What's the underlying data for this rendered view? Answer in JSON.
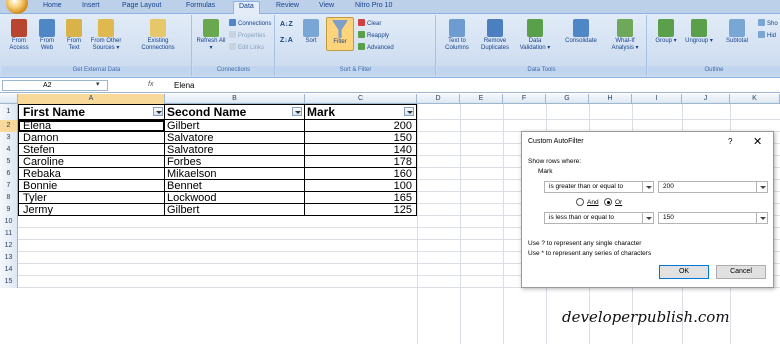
{
  "tabs": [
    "Home",
    "Insert",
    "Page Layout",
    "Formulas",
    "Data",
    "Review",
    "View",
    "Nitro Pro 10"
  ],
  "ribbon": {
    "get_external": {
      "label": "Get External Data",
      "buttons": [
        "From Access",
        "From Web",
        "From Text",
        "From Other Sources ▾",
        "Existing Connections"
      ]
    },
    "connections": {
      "label": "Connections",
      "refresh": "Refresh All ▾",
      "items": [
        "Connections",
        "Properties",
        "Edit Links"
      ]
    },
    "sort_filter": {
      "label": "Sort & Filter",
      "sort": "Sort",
      "filter": "Filter",
      "items": [
        "Clear",
        "Reapply",
        "Advanced"
      ]
    },
    "data_tools": {
      "label": "Data Tools",
      "buttons": [
        "Text to Columns",
        "Remove Duplicates",
        "Data Validation ▾",
        "Consolidate",
        "What-If Analysis ▾"
      ]
    },
    "outline": {
      "label": "Outline",
      "buttons": [
        "Group ▾",
        "Ungroup ▾",
        "Subtotal"
      ],
      "side": [
        "Sho",
        "Hid"
      ]
    }
  },
  "formula_bar": {
    "name_box": "A2",
    "fx": "fx",
    "value": "Elena"
  },
  "columns": [
    "A",
    "B",
    "C",
    "D",
    "E",
    "F",
    "G",
    "H",
    "I",
    "J",
    "K"
  ],
  "row_numbers": [
    "1",
    "2",
    "3",
    "4",
    "5",
    "6",
    "7",
    "8",
    "9",
    "10",
    "11",
    "12",
    "13",
    "14",
    "15"
  ],
  "table": {
    "headers": [
      "First Name",
      "Second Name",
      "Mark"
    ],
    "rows": [
      [
        "Elena",
        "Gilbert",
        "200"
      ],
      [
        "Damon",
        "Salvatore",
        "150"
      ],
      [
        "Stefen",
        "Salvatore",
        "140"
      ],
      [
        "Caroline",
        "Forbes",
        "178"
      ],
      [
        "Rebaka",
        "Mikaelson",
        "160"
      ],
      [
        "Bonnie",
        "Bennet",
        "100"
      ],
      [
        "Tyler",
        "Lockwood",
        "165"
      ],
      [
        "Jermy",
        "Gilbert",
        "125"
      ]
    ]
  },
  "dialog": {
    "title": "Custom AutoFilter",
    "help": "?",
    "close": "✕",
    "show_rows": "Show rows where:",
    "field": "Mark",
    "cond1_op": "is greater than or equal to",
    "cond1_val": "200",
    "and": "And",
    "or": "Or",
    "cond2_op": "is less than or equal to",
    "cond2_val": "150",
    "hint1": "Use ? to represent any single character",
    "hint2": "Use * to represent any series of characters",
    "ok": "OK",
    "cancel": "Cancel"
  },
  "watermark": "developerpublish.com",
  "colors": {
    "ribbon": "#c9d9ee",
    "selected_header": "#f9d99a",
    "filter_active": "#fdd47c"
  }
}
